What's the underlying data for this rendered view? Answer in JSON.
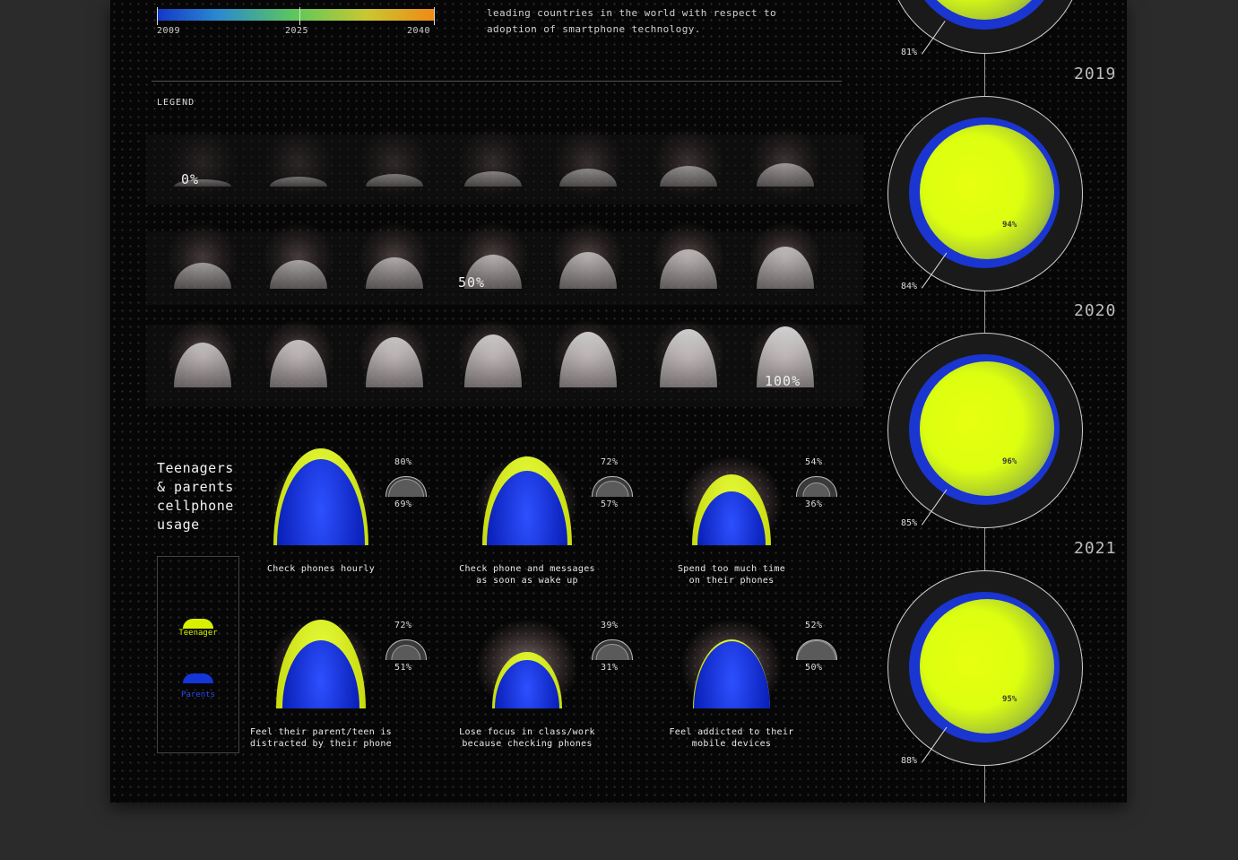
{
  "colorbar": {
    "ticks": [
      "2009",
      "2025",
      "2040"
    ]
  },
  "intro": {
    "text": "leading countries in the world with respect to adoption of smartphone technology."
  },
  "legend": {
    "title": "LEGEND",
    "scale_labels": [
      "0%",
      "50%",
      "100%"
    ],
    "fill_levels": [
      0,
      0.05,
      0.1,
      0.15,
      0.2,
      0.25,
      0.3,
      0.35,
      0.4,
      0.45,
      0.5,
      0.55,
      0.6,
      0.65,
      0.7,
      0.75,
      0.8,
      0.85,
      0.9,
      0.95,
      1.0
    ]
  },
  "usage": {
    "title_lines": [
      "Teenagers",
      "& parents",
      "cellphone",
      "usage"
    ],
    "key": {
      "teen_label": "Teenager",
      "parent_label": "Parents",
      "teen_color": "#d8f000",
      "parent_color": "#1435d8"
    },
    "items": [
      {
        "caption": [
          "Check phones hourly",
          ""
        ],
        "teen": "80%",
        "parents": "69%",
        "teen_val": 0.8,
        "parent_val": 0.69
      },
      {
        "caption": [
          "Check phone and messages",
          "as soon as wake up"
        ],
        "teen": "72%",
        "parents": "57%",
        "teen_val": 0.72,
        "parent_val": 0.57
      },
      {
        "caption": [
          "Spend too much time",
          "on their phones"
        ],
        "teen": "54%",
        "parents": "36%",
        "teen_val": 0.54,
        "parent_val": 0.36
      },
      {
        "caption": [
          "Feel their parent/teen is",
          "distracted by their phone"
        ],
        "teen": "72%",
        "parents": "51%",
        "teen_val": 0.72,
        "parent_val": 0.51
      },
      {
        "caption": [
          "Lose focus in class/work",
          "because checking phones"
        ],
        "teen": "39%",
        "parents": "31%",
        "teen_val": 0.39,
        "parent_val": 0.31
      },
      {
        "caption": [
          "Feel addicted to their",
          "mobile devices"
        ],
        "teen": "52%",
        "parents": "50%",
        "teen_val": 0.52,
        "parent_val": 0.5
      }
    ]
  },
  "timeline": {
    "top_outer": "81%",
    "years": [
      {
        "year": "2019",
        "inner": "94%",
        "outer": "84%"
      },
      {
        "year": "2020",
        "inner": "96%",
        "outer": "85%"
      },
      {
        "year": "2021",
        "inner": "95%",
        "outer": "88%"
      }
    ]
  }
}
